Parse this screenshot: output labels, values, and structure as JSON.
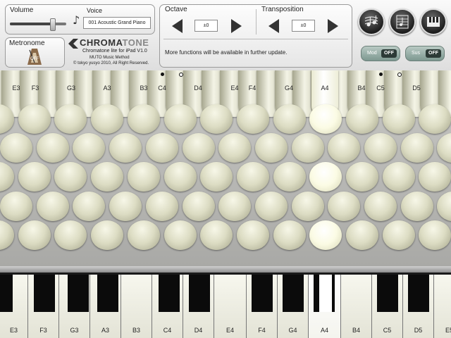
{
  "volume": {
    "label": "Volume",
    "level": 0.75
  },
  "voice": {
    "label": "Voice",
    "value": "001 Acoustic Grand Piano"
  },
  "metronome": {
    "label": "Metronome",
    "state": "OFF"
  },
  "brand": {
    "name_part1": "CHROMA",
    "name_part2": "TONE",
    "subtitle": "Chromatone lite for iPad V1.0",
    "method": "MUTO Music Method",
    "copyright": "© tokyo yusyo 2010, All Right Reserved."
  },
  "octave": {
    "label": "Octave",
    "value": "±0"
  },
  "transposition": {
    "label": "Transposition",
    "value": "±0"
  },
  "info": "More functions will be available in further update.",
  "mode_buttons": [
    {
      "name": "score",
      "icon": "score-icon"
    },
    {
      "name": "notes",
      "icon": "notes-icon"
    },
    {
      "name": "keyboard",
      "icon": "keyboard-icon"
    }
  ],
  "mod": {
    "label": "Mod",
    "state": "OFF"
  },
  "sus": {
    "label": "Sus",
    "state": "OFF"
  },
  "board_labels": [
    "E3",
    "F3",
    "G3",
    "A3",
    "B3",
    "C4",
    "D4",
    "E4",
    "F4",
    "G4",
    "A4",
    "B4",
    "C5",
    "D5"
  ],
  "piano_labels": [
    "E3",
    "F3",
    "G3",
    "A3",
    "B3",
    "C4",
    "D4",
    "E4",
    "F4",
    "G4",
    "A4",
    "B4",
    "C5",
    "D5",
    "E5"
  ],
  "active_note": "A4",
  "colors": {
    "accent_panel": "#7d9890",
    "button_face": "#dcdcc3",
    "highlight": "#ffffff"
  }
}
